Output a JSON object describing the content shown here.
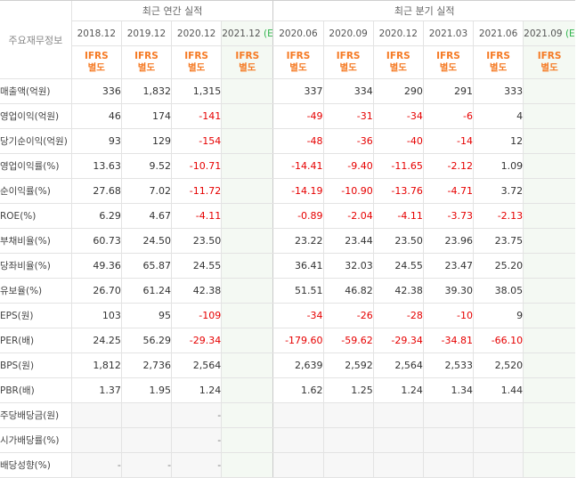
{
  "headers": {
    "corner": "주요재무정보",
    "annual": "최근 연간 실적",
    "quarterly": "최근 분기 실적",
    "estimate_mark": "(E)",
    "ifrs_line1": "IFRS",
    "ifrs_line2": "별도",
    "annual_periods": [
      "2018.12",
      "2019.12",
      "2020.12",
      "2021.12"
    ],
    "quarter_periods": [
      "2020.06",
      "2020.09",
      "2020.12",
      "2021.03",
      "2021.06",
      "2021.09"
    ]
  },
  "rows": [
    {
      "label": "매출액(억원)",
      "annual": [
        "336",
        "1,832",
        "1,315",
        ""
      ],
      "quarter": [
        "337",
        "334",
        "290",
        "291",
        "333",
        ""
      ]
    },
    {
      "label": "영업이익(억원)",
      "annual": [
        "46",
        "174",
        "-141",
        ""
      ],
      "quarter": [
        "-49",
        "-31",
        "-34",
        "-6",
        "4",
        ""
      ]
    },
    {
      "label": "당기순이익(억원)",
      "annual": [
        "93",
        "129",
        "-154",
        ""
      ],
      "quarter": [
        "-48",
        "-36",
        "-40",
        "-14",
        "12",
        ""
      ]
    },
    {
      "label": "영업이익률(%)",
      "annual": [
        "13.63",
        "9.52",
        "-10.71",
        ""
      ],
      "quarter": [
        "-14.41",
        "-9.40",
        "-11.65",
        "-2.12",
        "1.09",
        ""
      ]
    },
    {
      "label": "순이익률(%)",
      "annual": [
        "27.68",
        "7.02",
        "-11.72",
        ""
      ],
      "quarter": [
        "-14.19",
        "-10.90",
        "-13.76",
        "-4.71",
        "3.72",
        ""
      ]
    },
    {
      "label": "ROE(%)",
      "annual": [
        "6.29",
        "4.67",
        "-4.11",
        ""
      ],
      "quarter": [
        "-0.89",
        "-2.04",
        "-4.11",
        "-3.73",
        "-2.13",
        ""
      ]
    },
    {
      "label": "부채비율(%)",
      "annual": [
        "60.73",
        "24.50",
        "23.50",
        ""
      ],
      "quarter": [
        "23.22",
        "23.44",
        "23.50",
        "23.96",
        "23.75",
        ""
      ]
    },
    {
      "label": "당좌비율(%)",
      "annual": [
        "49.36",
        "65.87",
        "24.55",
        ""
      ],
      "quarter": [
        "36.41",
        "32.03",
        "24.55",
        "23.47",
        "25.20",
        ""
      ]
    },
    {
      "label": "유보율(%)",
      "annual": [
        "26.70",
        "61.24",
        "42.38",
        ""
      ],
      "quarter": [
        "51.51",
        "46.82",
        "42.38",
        "39.30",
        "38.05",
        ""
      ]
    },
    {
      "label": "EPS(원)",
      "annual": [
        "103",
        "95",
        "-109",
        ""
      ],
      "quarter": [
        "-34",
        "-26",
        "-28",
        "-10",
        "9",
        ""
      ]
    },
    {
      "label": "PER(배)",
      "annual": [
        "24.25",
        "56.29",
        "-29.34",
        ""
      ],
      "quarter": [
        "-179.60",
        "-59.62",
        "-29.34",
        "-34.81",
        "-66.10",
        ""
      ]
    },
    {
      "label": "BPS(원)",
      "annual": [
        "1,812",
        "2,736",
        "2,564",
        ""
      ],
      "quarter": [
        "2,639",
        "2,592",
        "2,564",
        "2,533",
        "2,520",
        ""
      ]
    },
    {
      "label": "PBR(배)",
      "annual": [
        "1.37",
        "1.95",
        "1.24",
        ""
      ],
      "quarter": [
        "1.62",
        "1.25",
        "1.24",
        "1.34",
        "1.44",
        ""
      ]
    },
    {
      "label": "주당배당금(원)",
      "annual": [
        "",
        "",
        "-",
        ""
      ],
      "quarter": [
        "",
        "",
        "",
        "",
        "",
        ""
      ]
    },
    {
      "label": "시가배당률(%)",
      "annual": [
        "",
        "",
        "-",
        ""
      ],
      "quarter": [
        "",
        "",
        "",
        "",
        "",
        ""
      ]
    },
    {
      "label": "배당성향(%)",
      "annual": [
        "-",
        "-",
        "-",
        ""
      ],
      "quarter": [
        "",
        "",
        "",
        "",
        "",
        ""
      ]
    }
  ]
}
